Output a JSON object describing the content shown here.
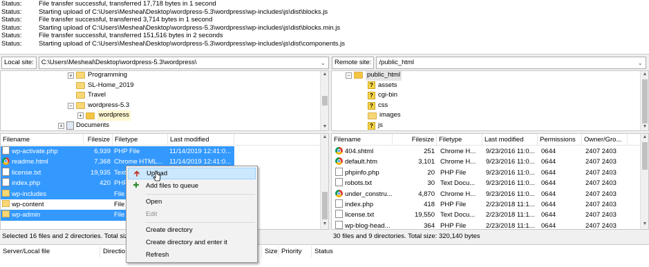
{
  "log": [
    {
      "status": "Status:",
      "message": "File transfer successful, transferred 17,718 bytes in 1 second"
    },
    {
      "status": "Status:",
      "message": "Starting upload of C:\\Users\\Mesheal\\Desktop\\wordpress-5.3\\wordpress\\wp-includes\\js\\dist\\blocks.js"
    },
    {
      "status": "Status:",
      "message": "File transfer successful, transferred 3,714 bytes in 1 second"
    },
    {
      "status": "Status:",
      "message": "Starting upload of C:\\Users\\Mesheal\\Desktop\\wordpress-5.3\\wordpress\\wp-includes\\js\\dist\\blocks.min.js"
    },
    {
      "status": "Status:",
      "message": "File transfer successful, transferred 151,516 bytes in 2 seconds"
    },
    {
      "status": "Status:",
      "message": "Starting upload of C:\\Users\\Mesheal\\Desktop\\wordpress-5.3\\wordpress\\wp-includes\\js\\dist\\components.js"
    }
  ],
  "local": {
    "site_label": "Local site:",
    "site_path": "C:\\Users\\Mesheal\\Desktop\\wordpress-5.3\\wordpress\\",
    "tree": [
      "Programming",
      "SL-Home_2019",
      "Travel",
      "wordpress-5.3",
      "wordpress",
      "Documents"
    ],
    "columns": [
      "Filename",
      "Filesize",
      "Filetype",
      "Last modified"
    ],
    "files": [
      {
        "name": "wp-activate.php",
        "size": "6,939",
        "type": "PHP File",
        "modified": "11/14/2019 12:41:0...",
        "icon": "file-icon"
      },
      {
        "name": "readme.html",
        "size": "7,368",
        "type": "Chrome HTML...",
        "modified": "11/14/2019 12:41:0...",
        "icon": "chrome-icon"
      },
      {
        "name": "license.txt",
        "size": "19,935",
        "type": "Text",
        "modified": "",
        "icon": "file-icon"
      },
      {
        "name": "index.php",
        "size": "420",
        "type": "PHP",
        "modified": "",
        "icon": "file-icon"
      },
      {
        "name": "wp-includes",
        "size": "",
        "type": "File",
        "modified": "",
        "icon": "folder-icon"
      },
      {
        "name": "wp-content",
        "size": "",
        "type": "File",
        "modified": "",
        "icon": "folder-icon"
      },
      {
        "name": "wp-admin",
        "size": "",
        "type": "File",
        "modified": "",
        "icon": "folder-icon"
      }
    ],
    "status": "Selected 16 files and 2 directories. Total size"
  },
  "remote": {
    "site_label": "Remote site:",
    "site_path": "/public_html",
    "tree": [
      "public_html",
      "assets",
      "cgi-bin",
      "css",
      "images",
      "js"
    ],
    "columns": [
      "Filename",
      "Filesize",
      "Filetype",
      "Last modified",
      "Permissions",
      "Owner/Gro..."
    ],
    "files": [
      {
        "name": "404.shtml",
        "size": "251",
        "type": "Chrome H...",
        "modified": "9/23/2016 11:0...",
        "perm": "0644",
        "owner": "2407 2403",
        "icon": "chrome-icon"
      },
      {
        "name": "default.htm",
        "size": "3,101",
        "type": "Chrome H...",
        "modified": "9/23/2016 11:0...",
        "perm": "0644",
        "owner": "2407 2403",
        "icon": "chrome-icon"
      },
      {
        "name": "phpinfo.php",
        "size": "20",
        "type": "PHP File",
        "modified": "9/23/2016 11:0...",
        "perm": "0644",
        "owner": "2407 2403",
        "icon": "file-icon"
      },
      {
        "name": "robots.txt",
        "size": "30",
        "type": "Text Docu...",
        "modified": "9/23/2016 11:0...",
        "perm": "0644",
        "owner": "2407 2403",
        "icon": "file-icon"
      },
      {
        "name": "under_constru...",
        "size": "4,870",
        "type": "Chrome H...",
        "modified": "9/23/2016 11:0...",
        "perm": "0644",
        "owner": "2407 2403",
        "icon": "chrome-icon"
      },
      {
        "name": "index.php",
        "size": "418",
        "type": "PHP File",
        "modified": "2/23/2018 11:1...",
        "perm": "0644",
        "owner": "2407 2403",
        "icon": "file-icon"
      },
      {
        "name": "license.txt",
        "size": "19,550",
        "type": "Text Docu...",
        "modified": "2/23/2018 11:1...",
        "perm": "0644",
        "owner": "2407 2403",
        "icon": "file-icon"
      },
      {
        "name": "wp-blog-head...",
        "size": "364",
        "type": "PHP File",
        "modified": "2/23/2018 11:1...",
        "perm": "0644",
        "owner": "2407 2403",
        "icon": "file-icon"
      }
    ],
    "status": "30 files and 9 directories. Total size: 320,140 bytes"
  },
  "context_menu": {
    "upload": "Upload",
    "add_to_queue": "Add files to queue",
    "open": "Open",
    "edit": "Edit",
    "create_dir": "Create directory",
    "create_dir_enter": "Create directory and enter it",
    "refresh": "Refresh"
  },
  "queue": {
    "columns": [
      "Server/Local file",
      "Directio",
      "Size",
      "Priority",
      "Status"
    ]
  },
  "colors": {
    "selection": "#3399ff",
    "menu_highlight": "#cce8ff"
  }
}
